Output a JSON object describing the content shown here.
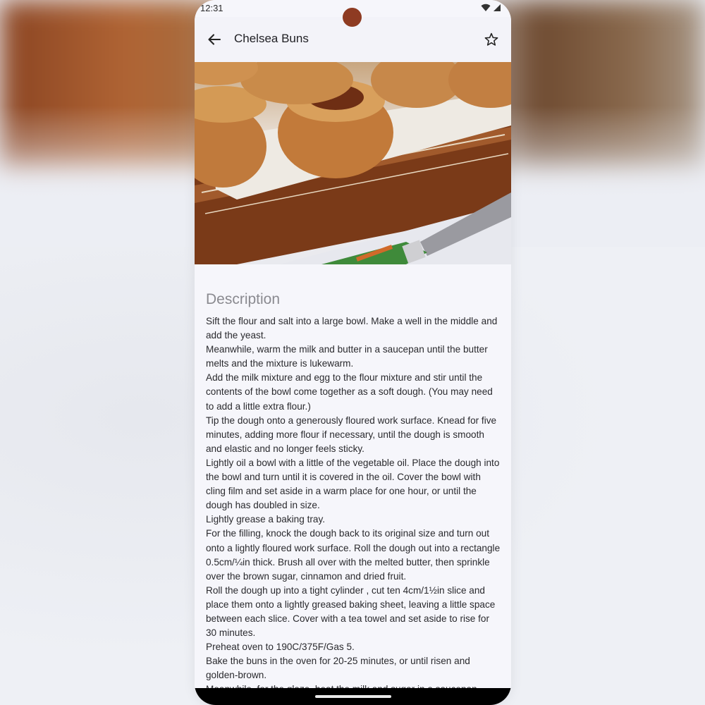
{
  "status_bar": {
    "time": "12:31",
    "icons": [
      "wifi-icon",
      "signal-icon"
    ]
  },
  "app_bar": {
    "back_icon": "arrow-back-icon",
    "title": "Chelsea Buns",
    "favorite_icon": "star-outline-icon"
  },
  "hero_image": {
    "subject": "chelsea buns on a wooden tray with a knife"
  },
  "description": {
    "heading": "Description",
    "text": "Sift the flour and salt into a large bowl. Make a well in the middle and add the yeast.\nMeanwhile, warm the milk and butter in a saucepan until the butter melts and the mixture is lukewarm.\nAdd the milk mixture and egg to the flour mixture and stir until the contents of the bowl come together as a soft dough. (You may need to add a little extra flour.)\nTip the dough onto a generously floured work surface. Knead for five minutes, adding more flour if necessary, until the dough is smooth and elastic and no longer feels sticky.\nLightly oil a bowl with a little of the vegetable oil. Place the dough into the bowl and turn until it is covered in the oil. Cover the bowl with cling film and set aside in a warm place for one hour, or until the dough has doubled in size.\nLightly grease a baking tray.\nFor the filling, knock the dough back to its original size and turn out onto a lightly floured work surface. Roll the dough out into a rectangle 0.5cm/¼in thick. Brush all over with the melted butter, then sprinkle over the brown sugar, cinnamon and dried fruit.\nRoll the dough up into a tight cylinder , cut ten 4cm/1½in slice and place them onto a lightly greased baking sheet, leaving a little space between each slice. Cover with a tea towel and set aside to rise for 30 minutes.\nPreheat oven to 190C/375F/Gas 5.\nBake the buns in the oven for 20-25 minutes, or until risen and golden-brown.\nMeanwhile, for the glaze, heat the milk and sugar in a saucepan"
  },
  "colors": {
    "background": "#f6f6fb",
    "camera": "#8e3b22",
    "heading": "#8a8a90"
  }
}
